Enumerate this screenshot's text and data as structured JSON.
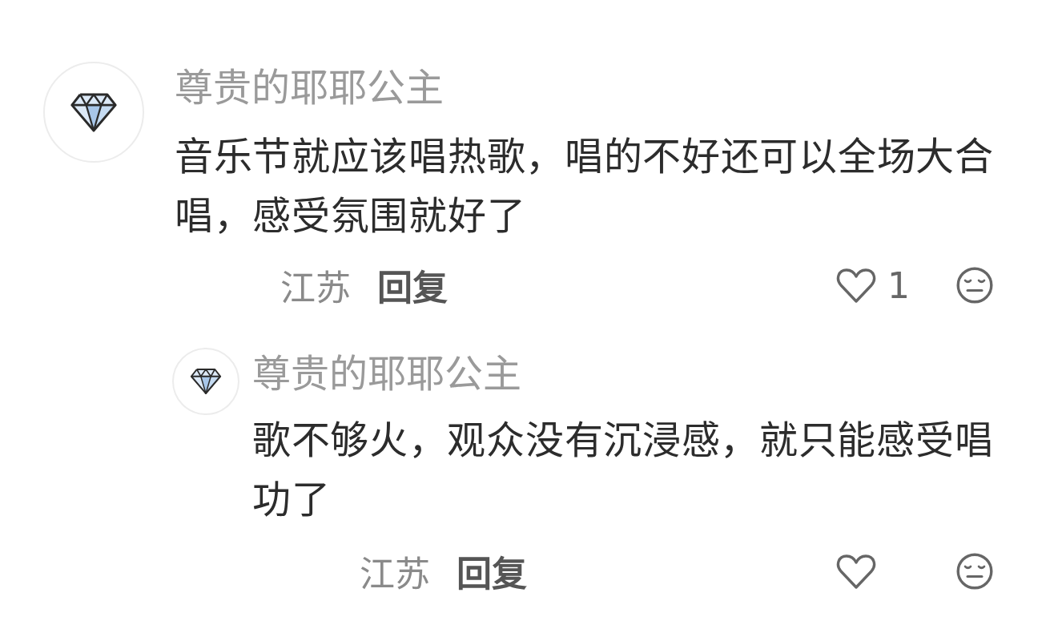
{
  "comments": [
    {
      "author": "尊贵的耶耶公主",
      "text": "音乐节就应该唱热歌，唱的不好还可以全场大合唱，感受氛围就好了",
      "location": "江苏",
      "reply_label": "回复",
      "likes": "1",
      "replies": [
        {
          "author": "尊贵的耶耶公主",
          "text": "歌不够火，观众没有沉浸感，就只能感受唱功了",
          "location": "江苏",
          "reply_label": "回复"
        }
      ]
    }
  ]
}
